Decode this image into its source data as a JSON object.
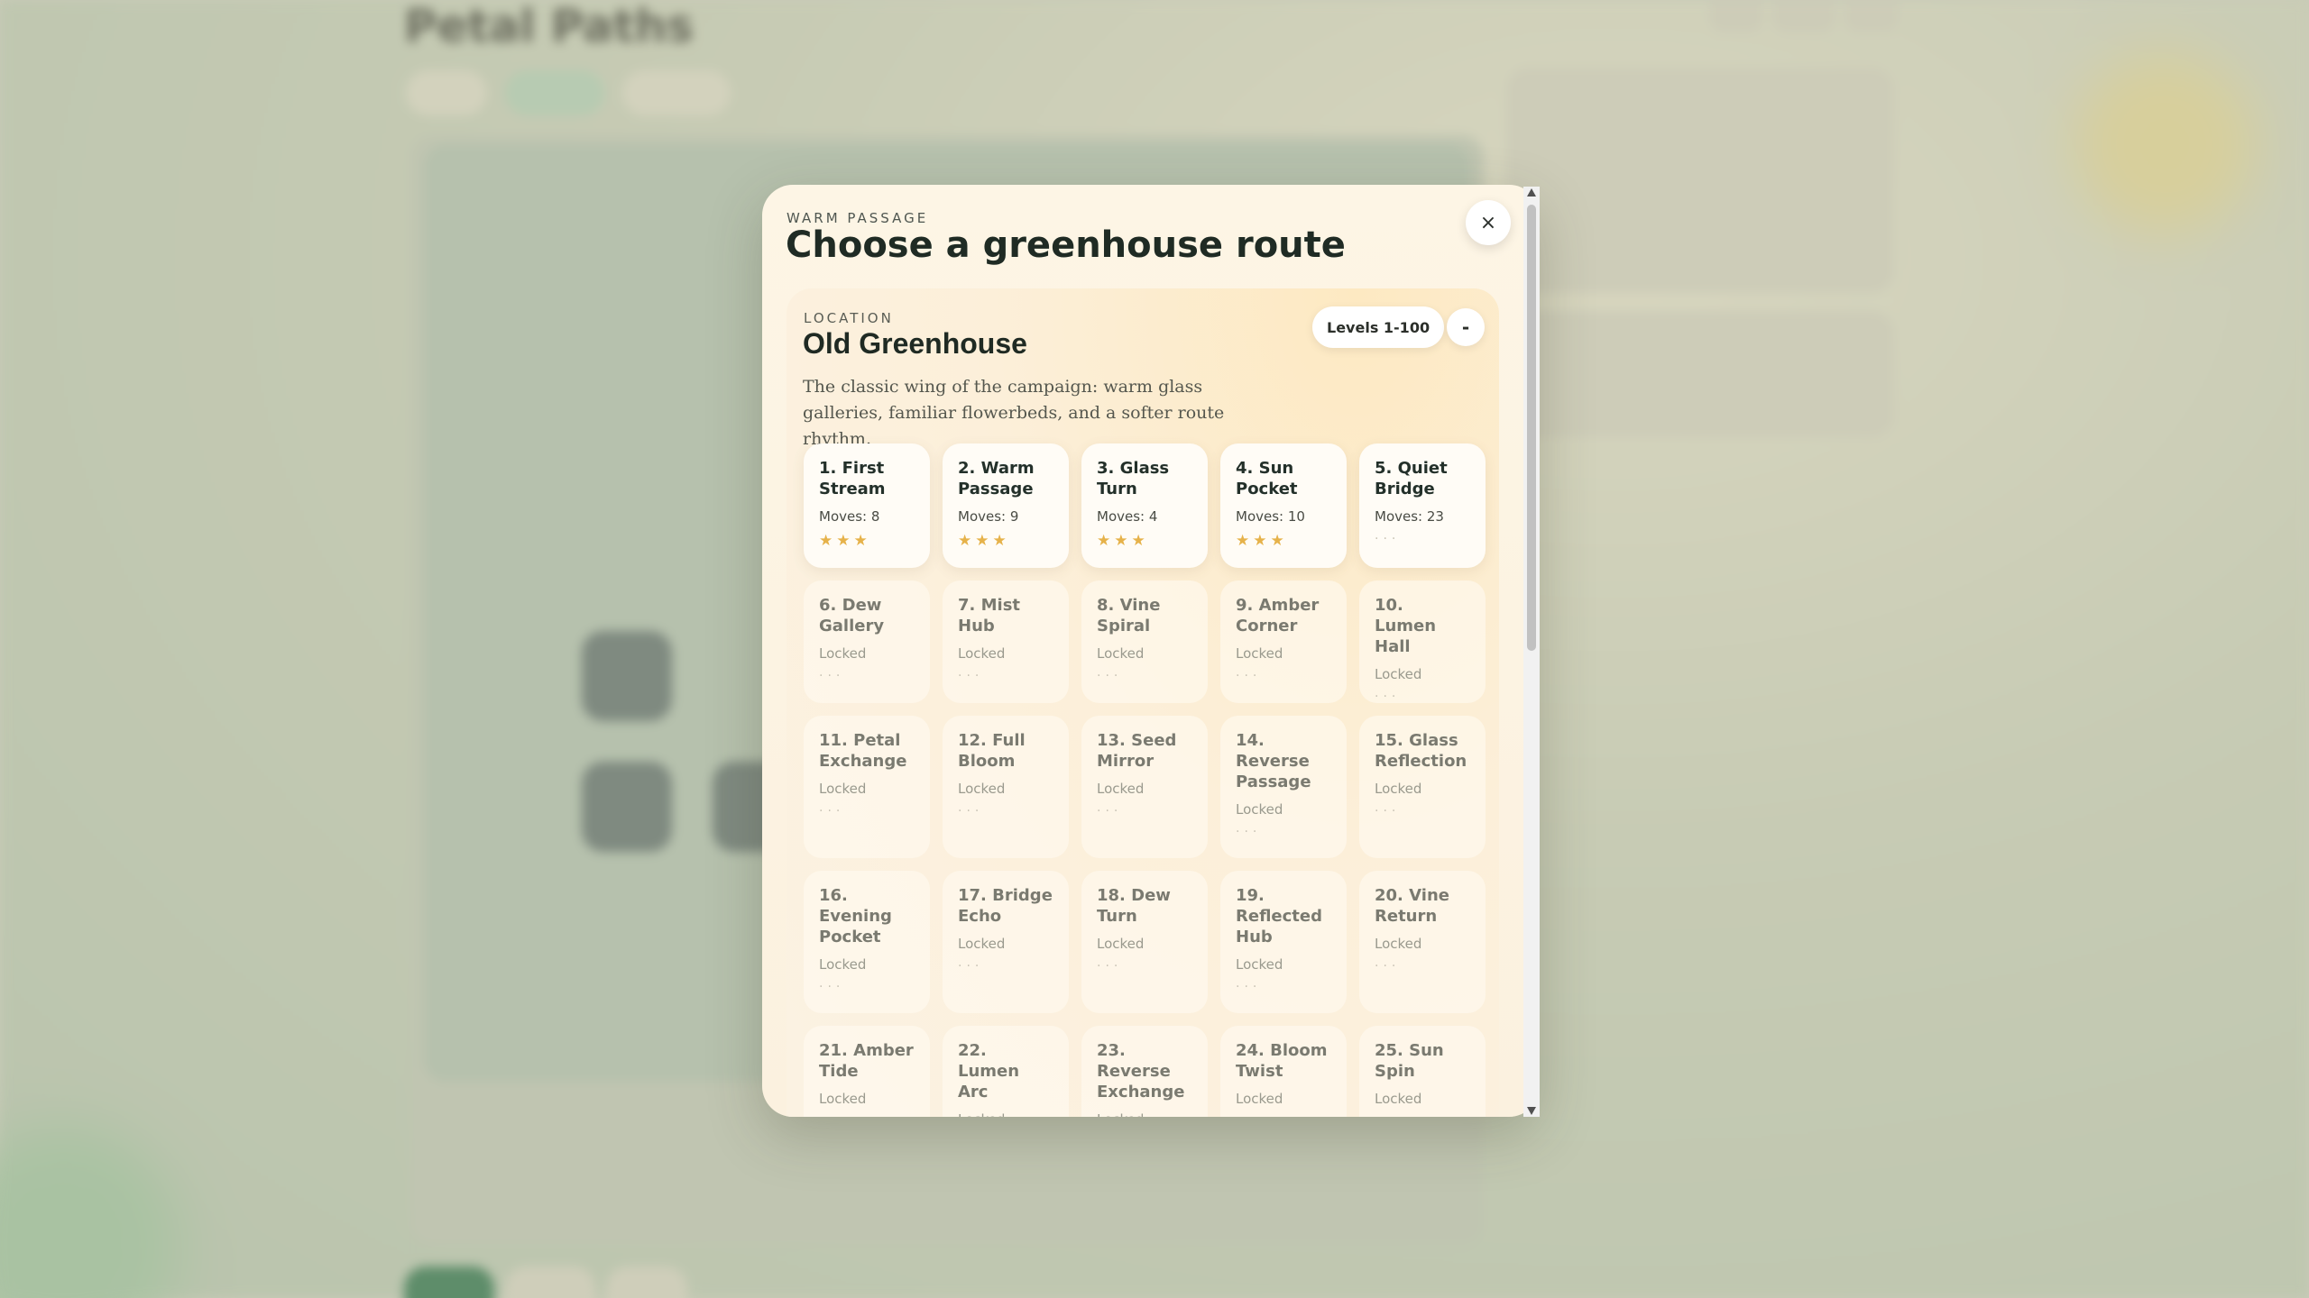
{
  "background": {
    "title": "Petal Paths"
  },
  "modal": {
    "eyebrow": "WARM PASSAGE",
    "title": "Choose a greenhouse route",
    "close_label": "×"
  },
  "location": {
    "label": "LOCATION",
    "name": "Old Greenhouse",
    "description": "The classic wing of the campaign: warm glass galleries, familiar flowerbeds, and a softer route rhythm.",
    "levels_range": "Levels 1-100",
    "collapse_label": "-"
  },
  "levels": [
    {
      "name": "1. First Stream",
      "meta": "Moves: 8",
      "stars": "★★★",
      "locked": false
    },
    {
      "name": "2. Warm Passage",
      "meta": "Moves: 9",
      "stars": "★★★",
      "locked": false
    },
    {
      "name": "3. Glass Turn",
      "meta": "Moves: 4",
      "stars": "★★★",
      "locked": false
    },
    {
      "name": "4. Sun Pocket",
      "meta": "Moves: 10",
      "stars": "★★★",
      "locked": false
    },
    {
      "name": "5. Quiet Bridge",
      "meta": "Moves: 23",
      "stars": "···",
      "locked": false
    },
    {
      "name": "6. Dew Gallery",
      "meta": "Locked",
      "stars": "···",
      "locked": true
    },
    {
      "name": "7. Mist Hub",
      "meta": "Locked",
      "stars": "···",
      "locked": true
    },
    {
      "name": "8. Vine Spiral",
      "meta": "Locked",
      "stars": "···",
      "locked": true
    },
    {
      "name": "9. Amber Corner",
      "meta": "Locked",
      "stars": "···",
      "locked": true
    },
    {
      "name": "10. Lumen Hall",
      "meta": "Locked",
      "stars": "···",
      "locked": true
    },
    {
      "name": "11. Petal Exchange",
      "meta": "Locked",
      "stars": "···",
      "locked": true
    },
    {
      "name": "12. Full Bloom",
      "meta": "Locked",
      "stars": "···",
      "locked": true
    },
    {
      "name": "13. Seed Mirror",
      "meta": "Locked",
      "stars": "···",
      "locked": true
    },
    {
      "name": "14. Reverse Passage",
      "meta": "Locked",
      "stars": "···",
      "locked": true
    },
    {
      "name": "15. Glass Reflection",
      "meta": "Locked",
      "stars": "···",
      "locked": true
    },
    {
      "name": "16. Evening Pocket",
      "meta": "Locked",
      "stars": "···",
      "locked": true
    },
    {
      "name": "17. Bridge Echo",
      "meta": "Locked",
      "stars": "···",
      "locked": true
    },
    {
      "name": "18. Dew Turn",
      "meta": "Locked",
      "stars": "···",
      "locked": true
    },
    {
      "name": "19. Reflected Hub",
      "meta": "Locked",
      "stars": "···",
      "locked": true
    },
    {
      "name": "20. Vine Return",
      "meta": "Locked",
      "stars": "···",
      "locked": true
    },
    {
      "name": "21. Amber Tide",
      "meta": "Locked",
      "stars": "···",
      "locked": true
    },
    {
      "name": "22. Lumen Arc",
      "meta": "Locked",
      "stars": "···",
      "locked": true
    },
    {
      "name": "23. Reverse Exchange",
      "meta": "Locked",
      "stars": "···",
      "locked": true
    },
    {
      "name": "24. Bloom Twist",
      "meta": "Locked",
      "stars": "···",
      "locked": true
    },
    {
      "name": "25. Sun Spin",
      "meta": "Locked",
      "stars": "···",
      "locked": true
    }
  ],
  "colors": {
    "star": "#e6b24a",
    "modal_bg": "#fdf5e5",
    "title": "#1f2b24"
  }
}
